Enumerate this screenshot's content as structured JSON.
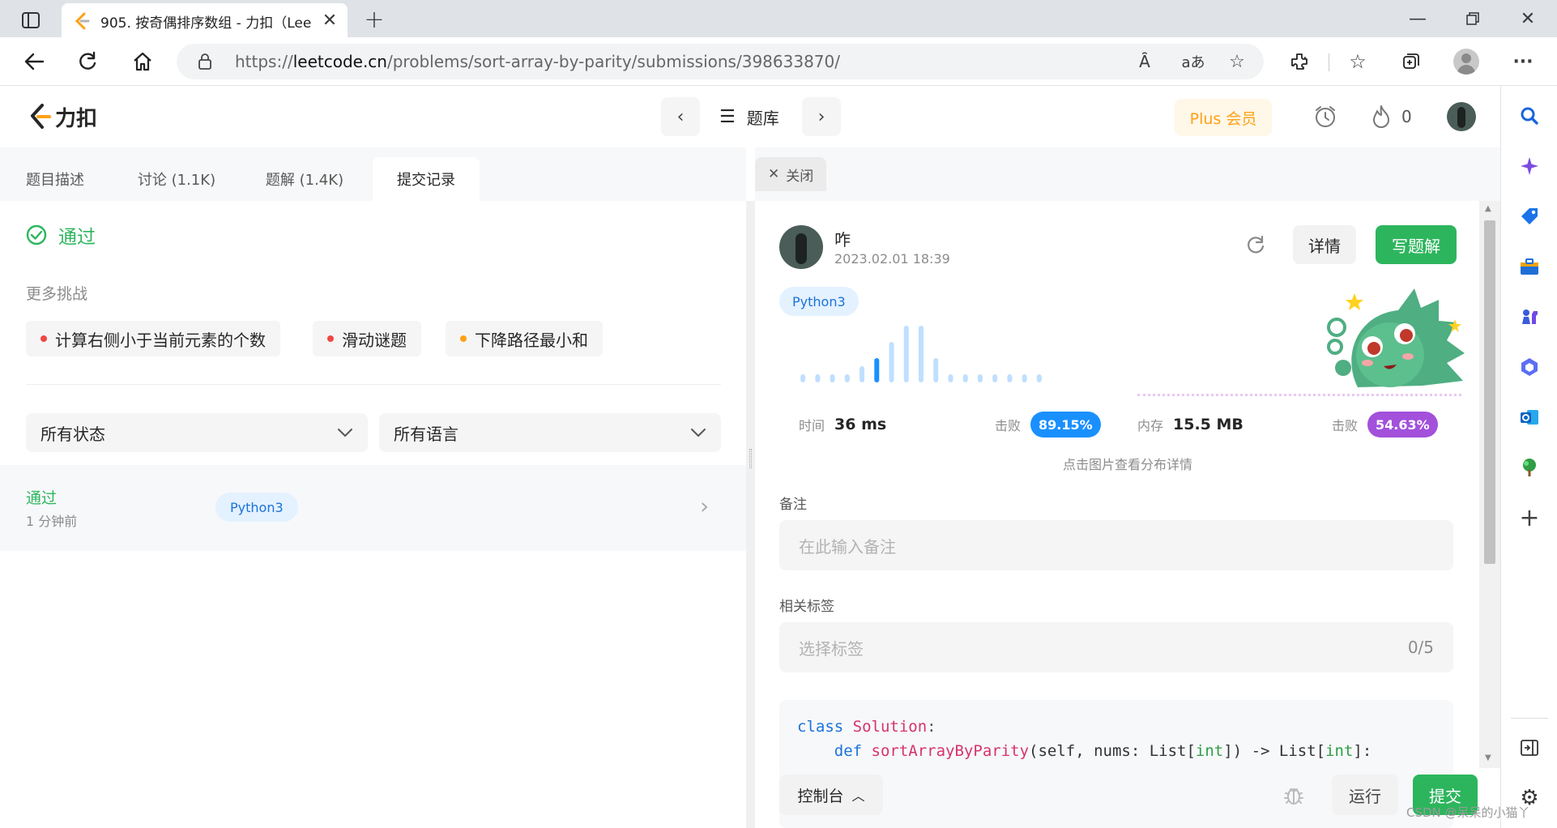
{
  "browser": {
    "tab_title": "905. 按奇偶排序数组 - 力扣（Lee",
    "url_prefix": "https://",
    "url_host": "leetcode.cn",
    "url_path": "/problems/sort-array-by-parity/submissions/398633870/",
    "new_tab": "+",
    "reader_label": "Ȃ",
    "translate_label": "aあ"
  },
  "site": {
    "logo_text": "力扣",
    "problem_bank": "题库",
    "plus": "Plus 会员",
    "streak": "0"
  },
  "left": {
    "tabs": [
      "题目描述",
      "讨论 (1.1K)",
      "题解 (1.4K)",
      "提交记录"
    ],
    "active_tab": 3,
    "status": "通过",
    "more_challenges": "更多挑战",
    "challenges": [
      {
        "label": "计算右侧小于当前元素的个数",
        "color": "#ef4743"
      },
      {
        "label": "滑动谜题",
        "color": "#ef4743"
      },
      {
        "label": "下降路径最小和",
        "color": "#ffa116"
      }
    ],
    "filters": [
      "所有状态",
      "所有语言"
    ],
    "submission": {
      "status": "通过",
      "time": "1 分钟前",
      "lang": "Python3"
    }
  },
  "right": {
    "close": "关闭",
    "user": "咋",
    "date": "2023.02.01 18:39",
    "details_btn": "详情",
    "solution_btn": "写题解",
    "lang": "Python3",
    "runtime": {
      "label": "时间",
      "value": "36 ms",
      "beats_label": "击败",
      "beats": "89.15%"
    },
    "memory": {
      "label": "内存",
      "value": "15.5 MB",
      "beats_label": "击败",
      "beats": "54.63%"
    },
    "dist_hint": "点击图片查看分布详情",
    "notes_label": "备注",
    "notes_placeholder": "在此输入备注",
    "tags_label": "相关标签",
    "tags_placeholder": "选择标签",
    "tags_count": "0/5",
    "code": {
      "line1_kw": "class",
      "line1_name": "Solution",
      "line1_tail": ":",
      "line2_kw": "def",
      "line2_fn": "sortArrayByParity",
      "line2_args": "(self, nums: List[",
      "line2_t1": "int",
      "line2_mid": "]) -> List[",
      "line2_t2": "int",
      "line2_end": "]:"
    },
    "console": "控制台",
    "run": "运行",
    "submit": "提交"
  },
  "runtime_histogram": {
    "type": "bar",
    "values": [
      1,
      1,
      1,
      1,
      2,
      3,
      5,
      7,
      7,
      3,
      1,
      1,
      1,
      1,
      1,
      1,
      1
    ],
    "highlight_index": 5,
    "color": "#bfdfff",
    "highlight_color": "#1a90ff"
  },
  "watermark": "CSDN @呆呆的小猫丫"
}
